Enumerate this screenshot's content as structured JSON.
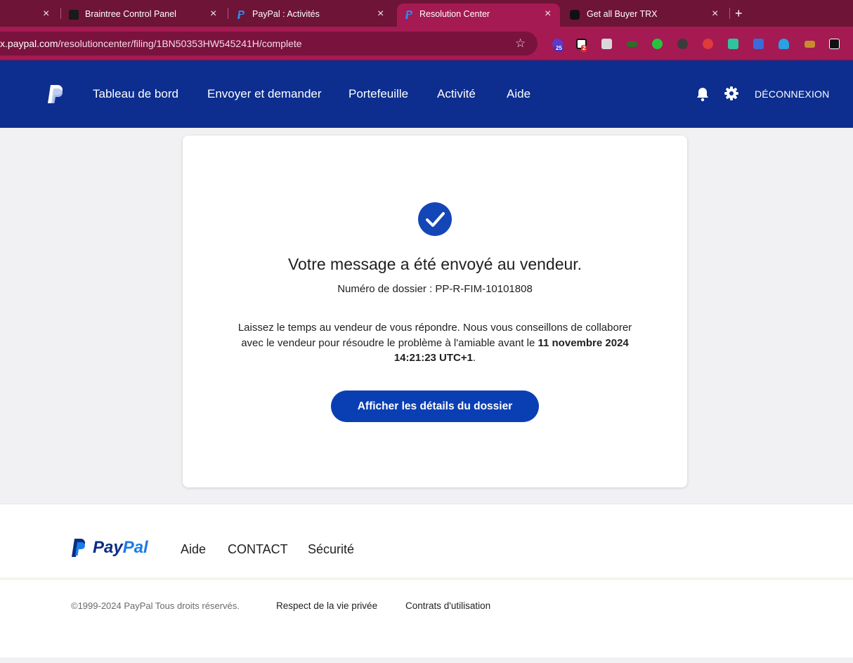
{
  "browser": {
    "tabs": [
      {
        "title": "Braintree Control Panel",
        "active": false
      },
      {
        "title": "PayPal : Activités",
        "active": false
      },
      {
        "title": "Resolution Center",
        "active": true
      },
      {
        "title": "Get all Buyer TRX",
        "active": false
      }
    ],
    "close_glyph": "×",
    "new_tab_glyph": "+",
    "url_host": "x.paypal.com",
    "url_path": "/resolutioncenter/filing/1BN50353HW545241H/complete",
    "bookmark_glyph": "☆",
    "extension_badges": {
      "first": "25",
      "second": "2"
    }
  },
  "header": {
    "nav": [
      "Tableau de bord",
      "Envoyer et demander",
      "Portefeuille",
      "Activité",
      "Aide"
    ],
    "logout_label": "DÉCONNEXION"
  },
  "card": {
    "heading": "Votre message a été envoyé au vendeur.",
    "case_number": "Numéro de dossier : PP-R-FIM-10101808",
    "message_prefix": "Laissez le temps au vendeur de vous répondre. Nous vous conseillons de collaborer avec le vendeur pour résoudre le problème à l'amiable avant le ",
    "message_date": "11 novembre 2024 14:21:23 UTC+1",
    "message_suffix": ".",
    "button_label": "Afficher les détails du dossier"
  },
  "footer": {
    "logo_pay": "Pay",
    "logo_pal": "Pal",
    "links": [
      "Aide",
      "CONTACT",
      "Sécurité"
    ],
    "copyright": "©1999-2024 PayPal Tous droits réservés.",
    "legal_links": [
      "Respect de la vie privée",
      "Contrats d'utilisation"
    ]
  },
  "colors": {
    "tabbar": "#6e1437",
    "toolbar": "#a51a52",
    "paypal_header": "#0d2e8f",
    "primary_button": "#0a3fb4"
  }
}
